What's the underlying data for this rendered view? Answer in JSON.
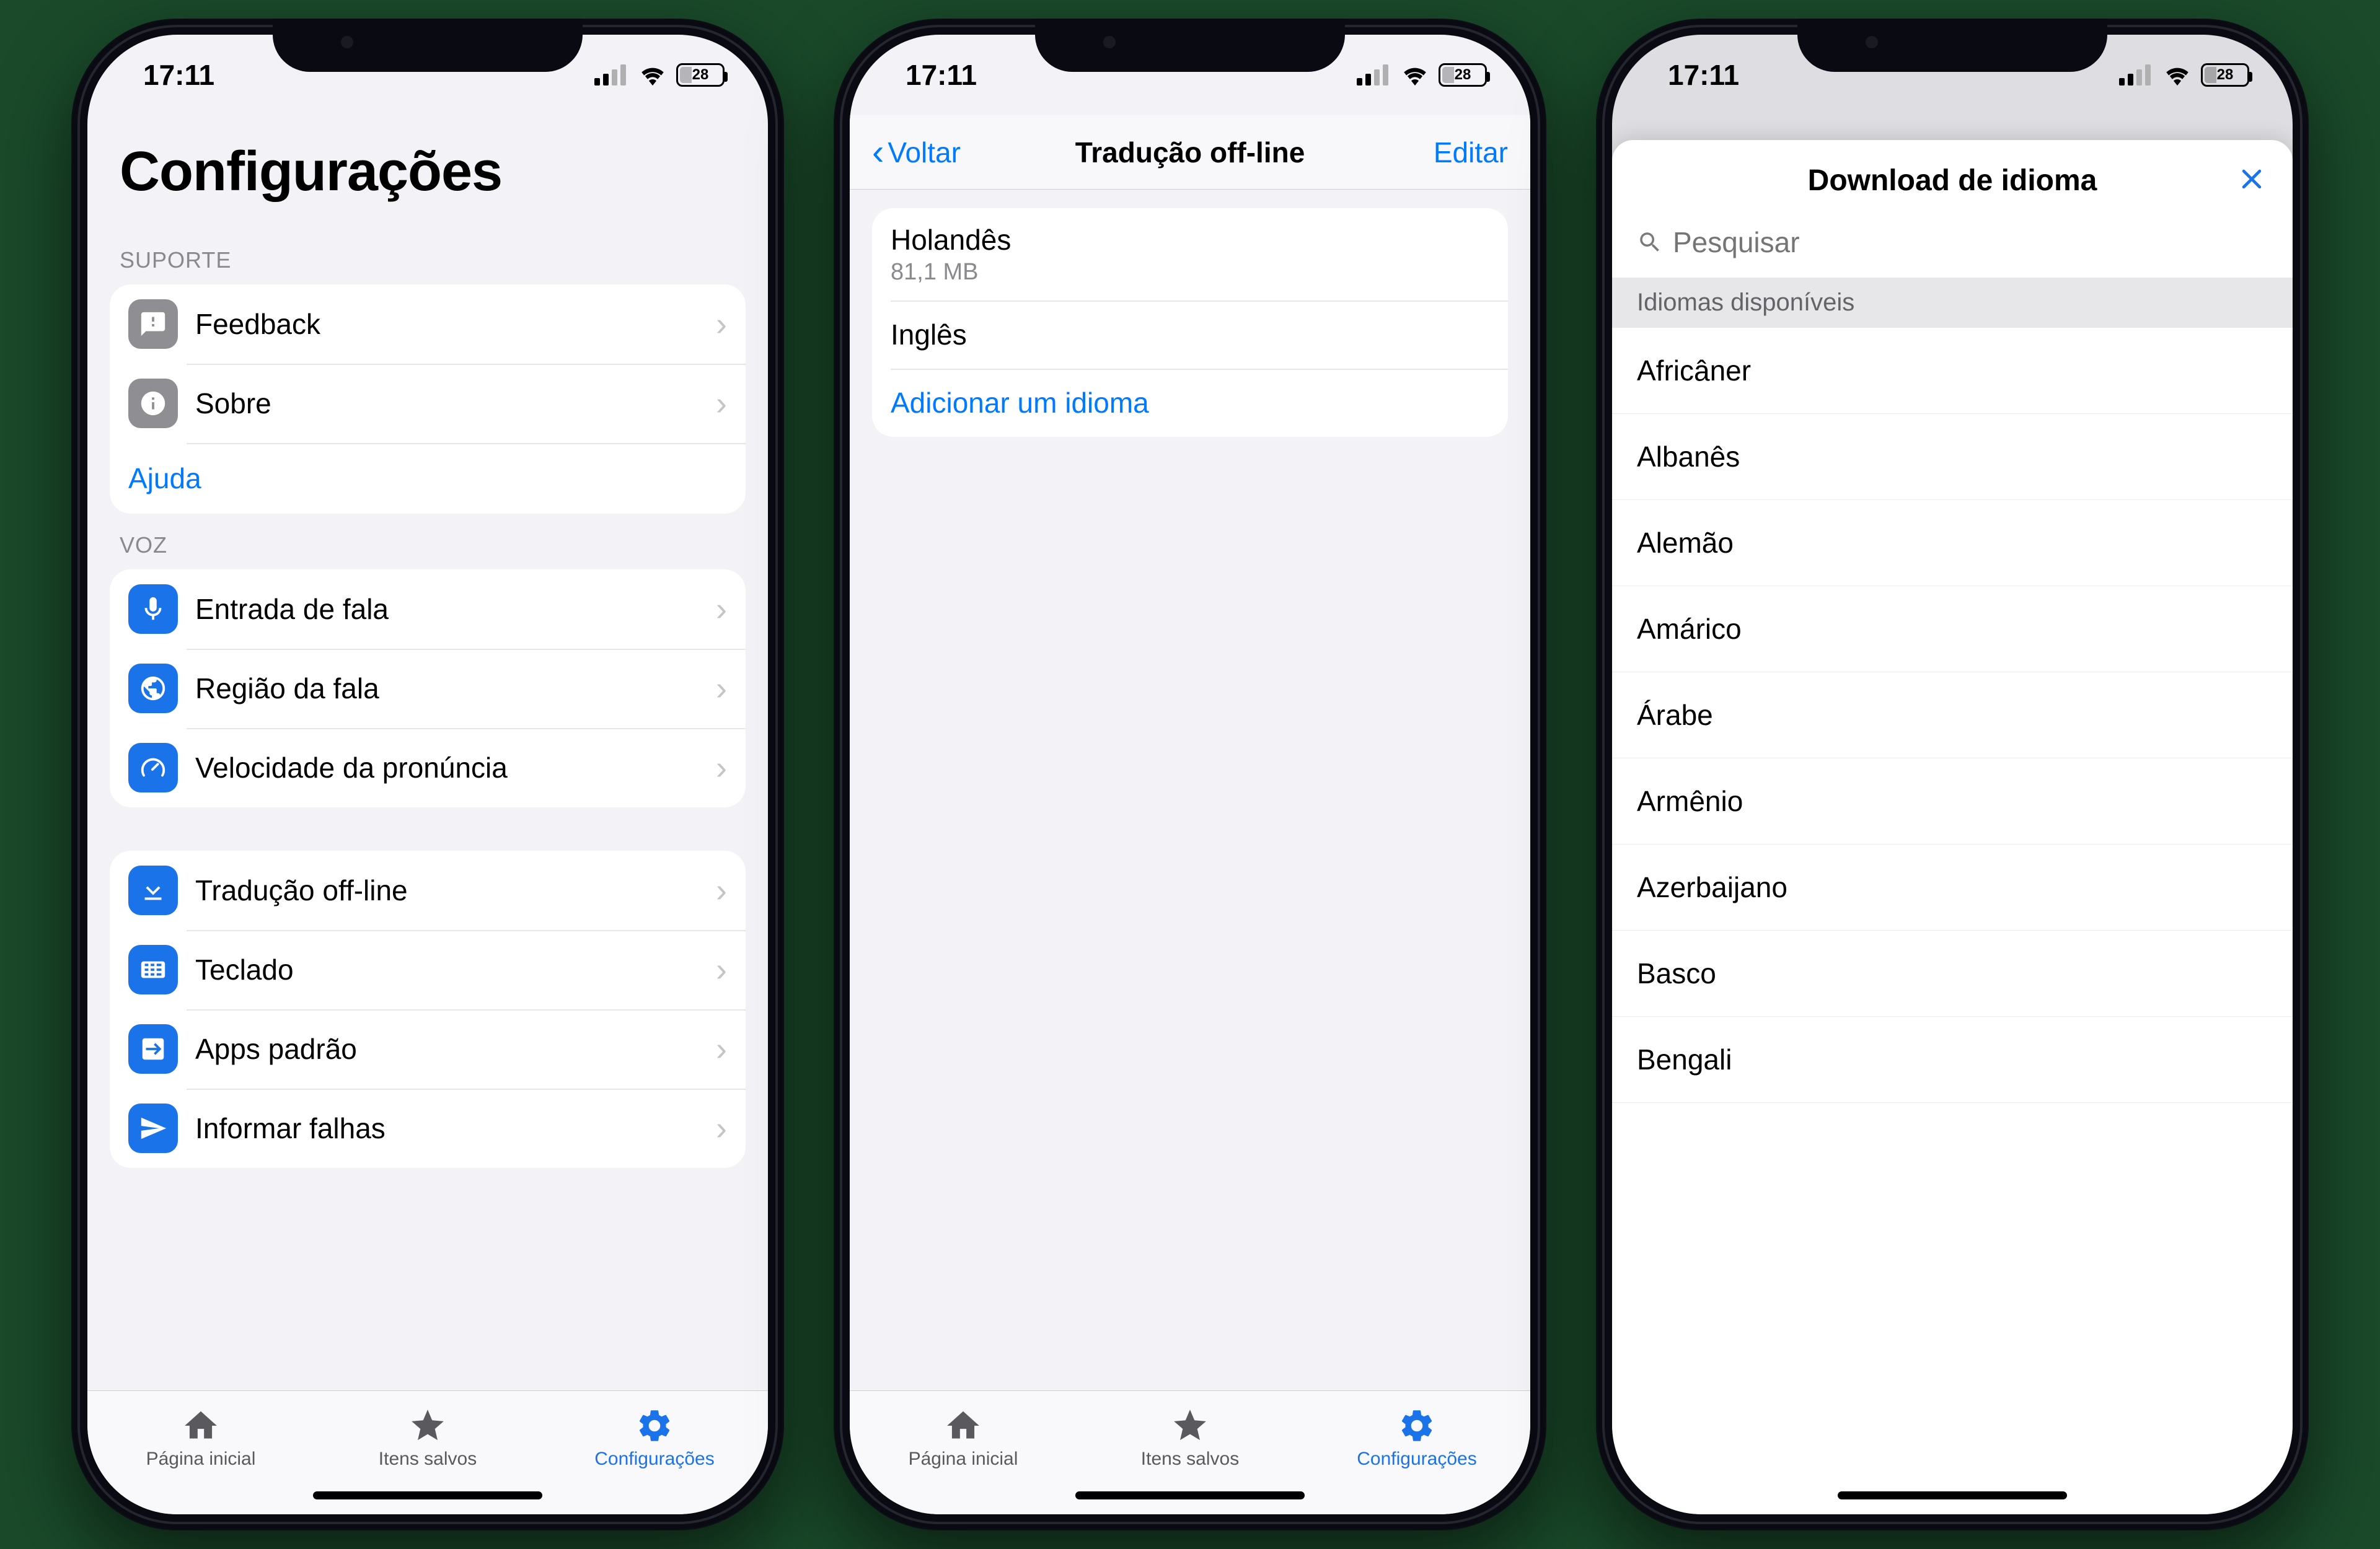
{
  "status": {
    "time": "17:11",
    "battery": "28"
  },
  "screen1": {
    "title": "Configurações",
    "support_header": "SUPORTE",
    "support": [
      {
        "label": "Feedback"
      },
      {
        "label": "Sobre"
      }
    ],
    "help": "Ajuda",
    "voice_header": "VOZ",
    "voice": [
      {
        "label": "Entrada de fala"
      },
      {
        "label": "Região da fala"
      },
      {
        "label": "Velocidade da pronúncia"
      }
    ],
    "other": [
      {
        "label": "Tradução off-line"
      },
      {
        "label": "Teclado"
      },
      {
        "label": "Apps padrão"
      },
      {
        "label": "Informar falhas"
      }
    ]
  },
  "screen2": {
    "back": "Voltar",
    "title": "Tradução off-line",
    "edit": "Editar",
    "lang1_name": "Holandês",
    "lang1_size": "81,1 MB",
    "lang2_name": "Inglês",
    "add": "Adicionar um idioma"
  },
  "screen3": {
    "title": "Download de idioma",
    "search_placeholder": "Pesquisar",
    "section": "Idiomas disponíveis",
    "languages": [
      "Africâner",
      "Albanês",
      "Alemão",
      "Amárico",
      "Árabe",
      "Armênio",
      "Azerbaijano",
      "Basco",
      "Bengali"
    ]
  },
  "tabs": {
    "home": "Página inicial",
    "saved": "Itens salvos",
    "settings": "Configurações"
  }
}
